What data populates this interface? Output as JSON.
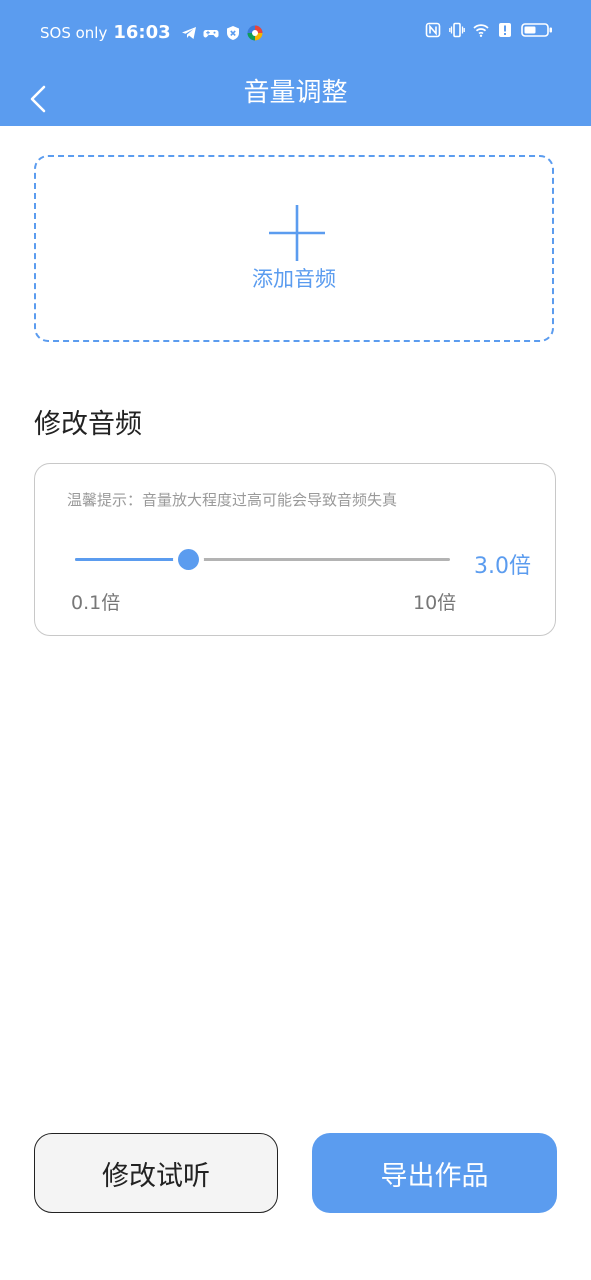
{
  "status_bar": {
    "carrier": "SOS only",
    "time": "16:03",
    "left_icons": [
      "telegram-icon",
      "game-controller-icon",
      "shield-icon",
      "colorful-app-icon"
    ],
    "right_icons": [
      "nfc-icon",
      "vibrate-icon",
      "wifi-icon",
      "alert-icon",
      "battery-icon"
    ]
  },
  "nav": {
    "back_icon": "chevron-left-icon",
    "title": "音量调整"
  },
  "add_audio": {
    "icon": "plus-icon",
    "label": "添加音频"
  },
  "modify_section": {
    "title": "修改音频",
    "tip": "温馨提示：音量放大程度过高可能会导致音频失真",
    "slider": {
      "value": 3.0,
      "min": 0.1,
      "max": 10,
      "fill_fraction": 0.3,
      "value_text": "3.0倍",
      "min_text": "0.1倍",
      "max_text": "10倍"
    }
  },
  "buttons": {
    "preview": "修改试听",
    "export": "导出作品"
  },
  "colors": {
    "accent": "#5B9CEF",
    "track": "#B3B3B3",
    "hint_text": "#9A9A9A"
  }
}
